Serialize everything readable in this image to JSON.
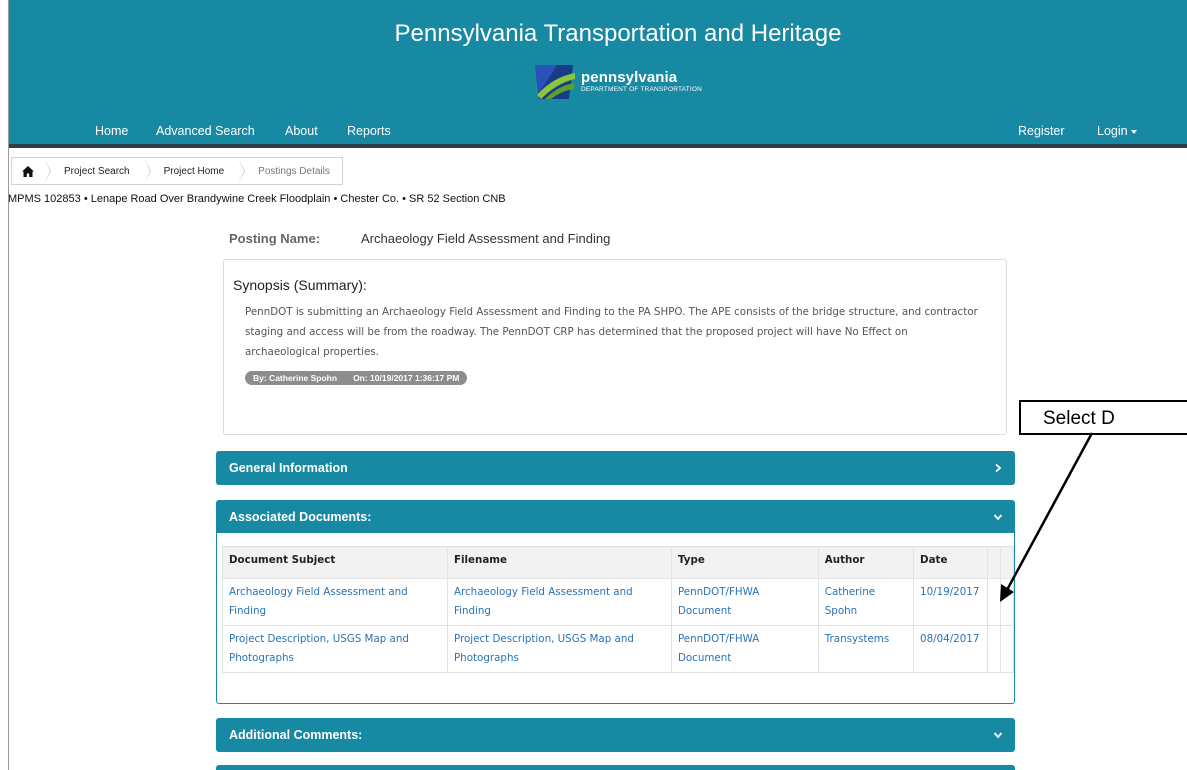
{
  "header": {
    "title": "Pennsylvania Transportation and Heritage",
    "brand_name": "pennsylvania",
    "brand_sub": "DEPARTMENT OF TRANSPORTATION",
    "color": "#1889a3"
  },
  "nav": {
    "left": [
      "Home",
      "Advanced Search",
      "About",
      "Reports"
    ],
    "register": "Register",
    "login": "Login"
  },
  "breadcrumb": {
    "home_icon": "home-icon",
    "items": [
      "Project Search",
      "Project Home",
      "Postings Details"
    ]
  },
  "project_line": "MPMS 102853 • Lenape Road Over Brandywine Creek Floodplain • Chester Co. • SR 52 Section CNB",
  "posting": {
    "label": "Posting Name:",
    "value": "Archaeology Field Assessment and Finding"
  },
  "synopsis": {
    "title": "Synopsis (Summary):",
    "text": "PennDOT is submitting an Archaeology Field Assessment and Finding to the PA SHPO. The APE consists of the bridge structure, and contractor staging and access will be from the roadway. The PennDOT CRP has determined that the proposed project will have No Effect on archaeological properties.",
    "by": "By: Catherine Spohn",
    "on": "On: 10/19/2017 1:36:17 PM"
  },
  "panels": {
    "general": "General Information",
    "documents": "Associated Documents:",
    "comments": "Additional Comments:"
  },
  "documents": {
    "columns": [
      "Document Subject",
      "Filename",
      "Type",
      "Author",
      "Date"
    ],
    "rows": [
      {
        "subject": [
          "Archaeology Field Assessment and",
          "Finding"
        ],
        "filename": [
          "Archaeology Field Assessment and",
          "Finding"
        ],
        "type": [
          "PennDOT/FHWA",
          "Document"
        ],
        "author": [
          "Catherine",
          "Spohn"
        ],
        "date": "10/19/2017"
      },
      {
        "subject": [
          "Project Description, USGS Map and",
          "Photographs"
        ],
        "filename": [
          "Project Description, USGS Map and",
          "Photographs"
        ],
        "type": [
          "PennDOT/FHWA",
          "Document"
        ],
        "author": [
          "Transystems"
        ],
        "date": "08/04/2017"
      }
    ]
  },
  "callout": {
    "text": "Select D"
  }
}
